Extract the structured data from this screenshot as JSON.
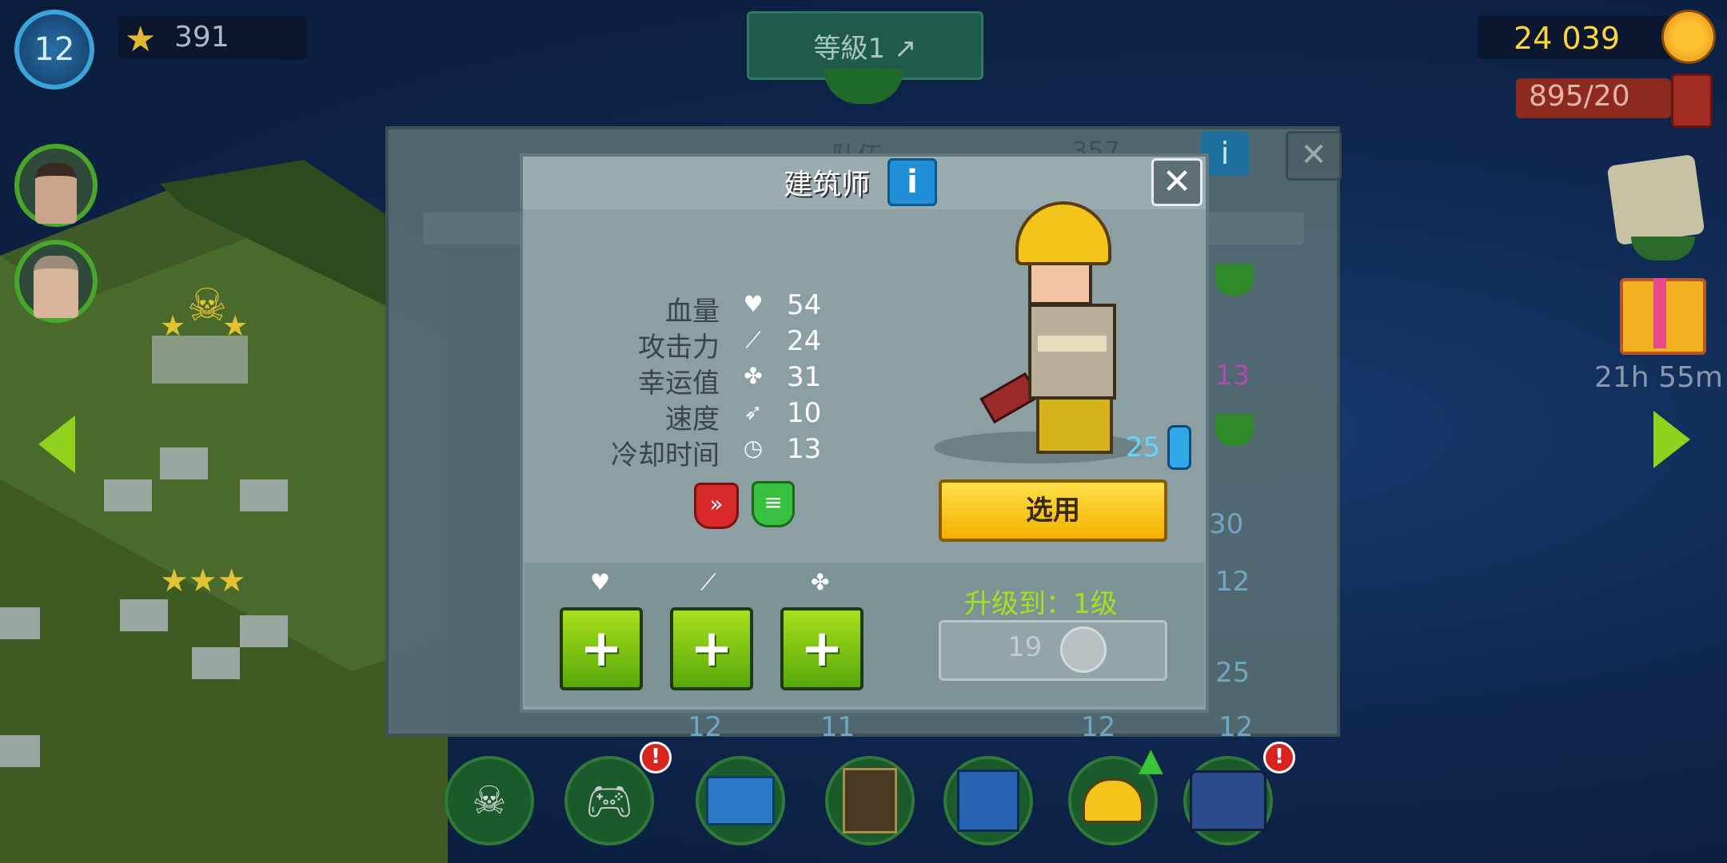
{
  "hud": {
    "player_level": "12",
    "stars": "391",
    "rank_label": "等級1 ↗",
    "coins": "24 039",
    "fuel": "895/20",
    "timer": "21h 55m"
  },
  "background_panel": {
    "title": "队伍",
    "count": "357",
    "info_label": "i",
    "close_label": "✕",
    "numbers": [
      "13",
      "30",
      "12",
      "25",
      "12",
      "11",
      "12",
      "12"
    ]
  },
  "dialog": {
    "title": "建筑师",
    "info_label": "i",
    "close_label": "✕",
    "stats": [
      {
        "label": "血量",
        "icon": "heart-icon",
        "glyph": "♥",
        "value": "54"
      },
      {
        "label": "攻击力",
        "icon": "sword-icon",
        "glyph": "⟋",
        "value": "24"
      },
      {
        "label": "幸运值",
        "icon": "clover-icon",
        "glyph": "✤",
        "value": "31"
      },
      {
        "label": "速度",
        "icon": "boot-icon",
        "glyph": "➶",
        "value": "10"
      },
      {
        "label": "冷却时间",
        "icon": "stopwatch-icon",
        "glyph": "◷",
        "value": "13"
      }
    ],
    "badge_red_glyph": "»",
    "badge_green_glyph": "≡",
    "cost": "25",
    "select_label": "选用",
    "upgrade": {
      "icons": [
        "♥",
        "⟋",
        "✤"
      ],
      "plus_label": "+",
      "label": "升级到：1级",
      "cost": "19"
    }
  },
  "colors": {
    "accent_green": "#8fd11c",
    "gold": "#ffd63a",
    "select_yellow": "#f3b000",
    "dialog_bg": "#8c9fa2"
  }
}
